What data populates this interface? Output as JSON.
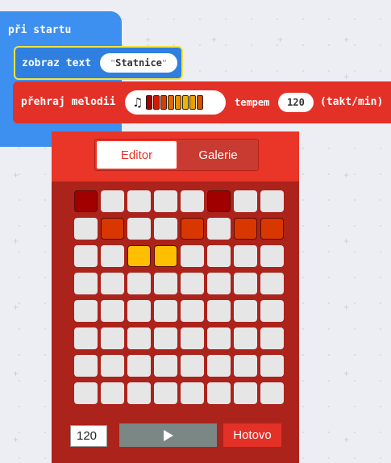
{
  "workspace": {
    "on_start_label": "při startu",
    "show_text": {
      "label": "zobraz text",
      "value": "Statnice"
    },
    "play_melody": {
      "label": "přehraj melodii",
      "tempo_label": "tempem",
      "tempo_value": "120",
      "unit_label": "(takt/min)",
      "preview_colors": [
        "#a50000",
        "#d21c00",
        "#d83c00",
        "#e06c00",
        "#e89000",
        "#f0b400",
        "#e8a000",
        "#d85000"
      ]
    }
  },
  "editor": {
    "tabs": [
      {
        "label": "Editor",
        "active": true
      },
      {
        "label": "Galerie",
        "active": false
      }
    ],
    "grid": {
      "rows": 8,
      "cols": 8,
      "empty_color": "#e6e6e6",
      "filled": [
        {
          "row": 0,
          "col": 0,
          "color": "#a10000"
        },
        {
          "row": 0,
          "col": 5,
          "color": "#a10000"
        },
        {
          "row": 1,
          "col": 1,
          "color": "#d83800"
        },
        {
          "row": 1,
          "col": 4,
          "color": "#d83800"
        },
        {
          "row": 1,
          "col": 6,
          "color": "#d83800"
        },
        {
          "row": 1,
          "col": 7,
          "color": "#d83800"
        },
        {
          "row": 2,
          "col": 2,
          "color": "#ffbe00"
        },
        {
          "row": 2,
          "col": 3,
          "color": "#ffbe00"
        }
      ]
    },
    "bpm_value": "120",
    "play_icon": "play-icon",
    "done_label": "Hotovo"
  }
}
